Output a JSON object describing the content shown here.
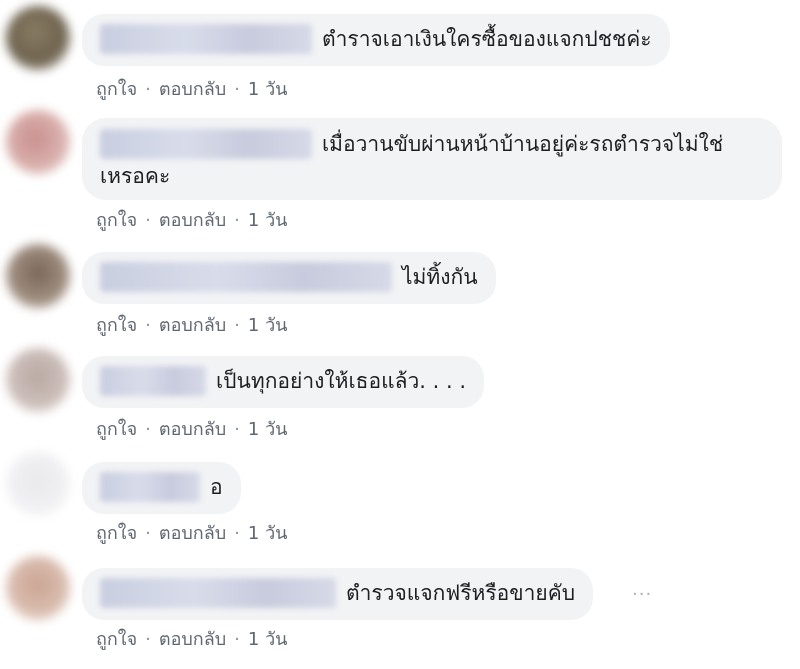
{
  "comments": [
    {
      "text": "ตำราจเอาเงินใครซื้อของแจกปชชค่ะ",
      "actions": {
        "like": "ถูกใจ",
        "reply": "ตอบกลับ",
        "time": "1 วัน"
      }
    },
    {
      "text": "เมื่อวานขับผ่านหน้าบ้านอยู่ค่ะรถตำรวจไม่ใช่",
      "text2": "เหรอคะ",
      "actions": {
        "like": "ถูกใจ",
        "reply": "ตอบกลับ",
        "time": "1 วัน"
      }
    },
    {
      "text": "ไม่ทิ้งกัน",
      "actions": {
        "like": "ถูกใจ",
        "reply": "ตอบกลับ",
        "time": "1 วัน"
      }
    },
    {
      "text": "เป็นทุกอย่างให้เธอแล้ว. . . .",
      "actions": {
        "like": "ถูกใจ",
        "reply": "ตอบกลับ",
        "time": "1 วัน"
      }
    },
    {
      "text": "อ",
      "actions": {
        "like": "ถูกใจ",
        "reply": "ตอบกลับ",
        "time": "1 วัน"
      }
    },
    {
      "text": "ตำรวจแจกฟรีหรือขายคับ",
      "more": "···",
      "actions": {
        "like": "ถูกใจ",
        "reply": "ตอบกลับ",
        "time": "1 วัน"
      }
    }
  ],
  "separator": "·",
  "colors": {
    "bubble": "#f2f3f5",
    "action_text": "#606770",
    "text": "#1c1e21"
  }
}
